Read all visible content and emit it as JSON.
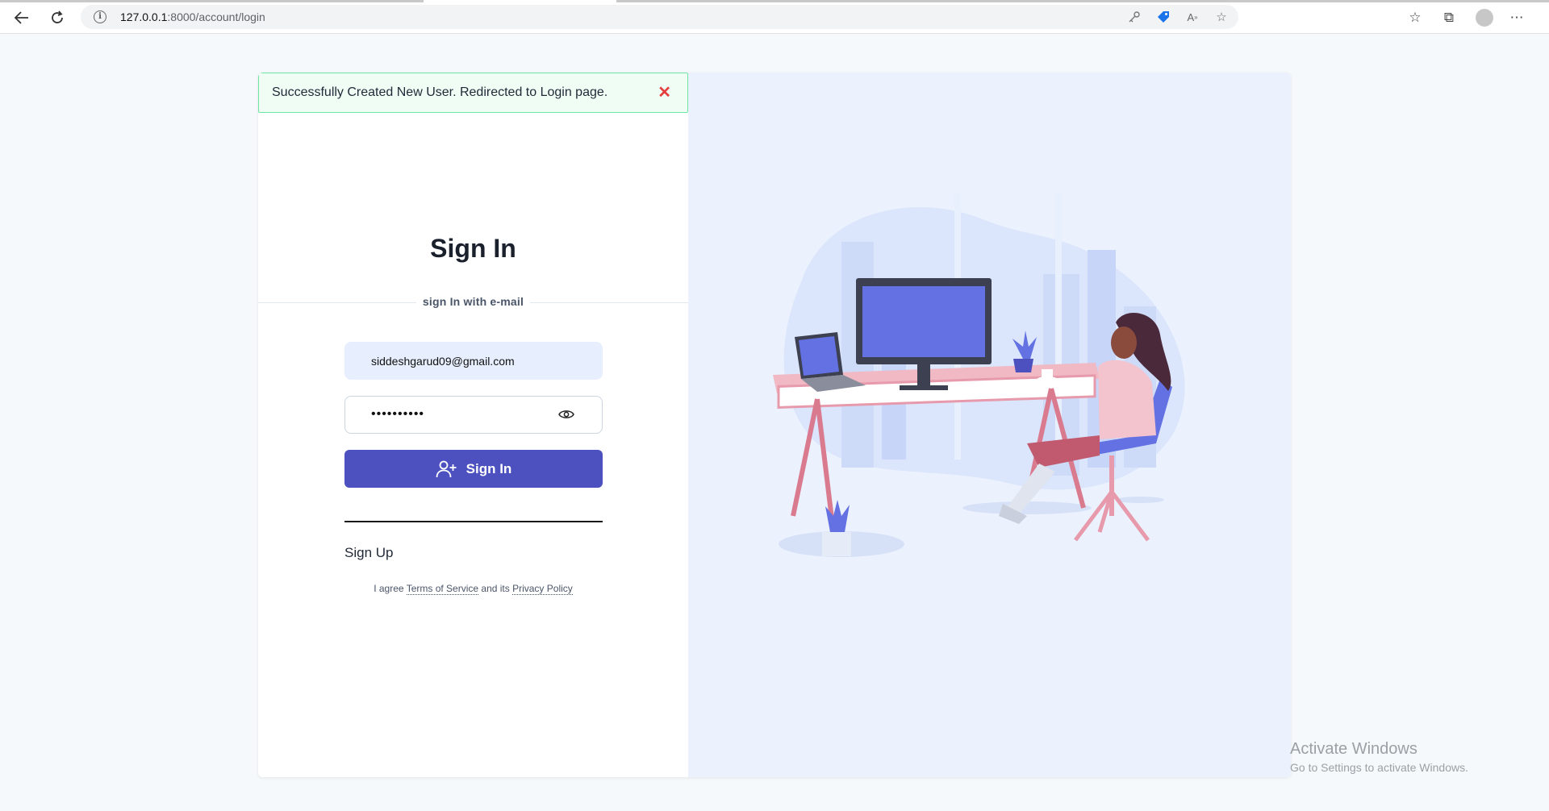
{
  "browser": {
    "url_host": "127.0.0.1",
    "url_path": ":8000/account/login"
  },
  "alert": {
    "message": "Successfully Created New User. Redirected to Login page.",
    "close_symbol": "✕"
  },
  "form": {
    "title": "Sign In",
    "divider_text": "sign In with e-mail",
    "email_value": "siddeshgarud09@gmail.com",
    "password_masked": "••••••••••",
    "submit_label": "Sign In",
    "signup_label": "Sign Up",
    "terms_prefix": "I agree",
    "terms_link": "Terms of Service",
    "terms_middle": "and its",
    "privacy_link": "Privacy Policy"
  },
  "watermark": {
    "title": "Activate Windows",
    "subtitle": "Go to Settings to activate Windows."
  },
  "colors": {
    "primary": "#4c51bf",
    "alert_bg": "#f0fdf4",
    "alert_border": "#6ee7a4",
    "alert_close": "#e53e3e",
    "illustration_bg": "#ebf2fe"
  },
  "icons": [
    "back-arrow-icon",
    "refresh-icon",
    "info-icon",
    "key-icon",
    "tag-icon",
    "read-aloud-icon",
    "favorite-star-icon",
    "favorites-icon",
    "collections-icon",
    "profile-icon",
    "more-icon",
    "close-icon",
    "eye-icon",
    "user-plus-icon"
  ]
}
